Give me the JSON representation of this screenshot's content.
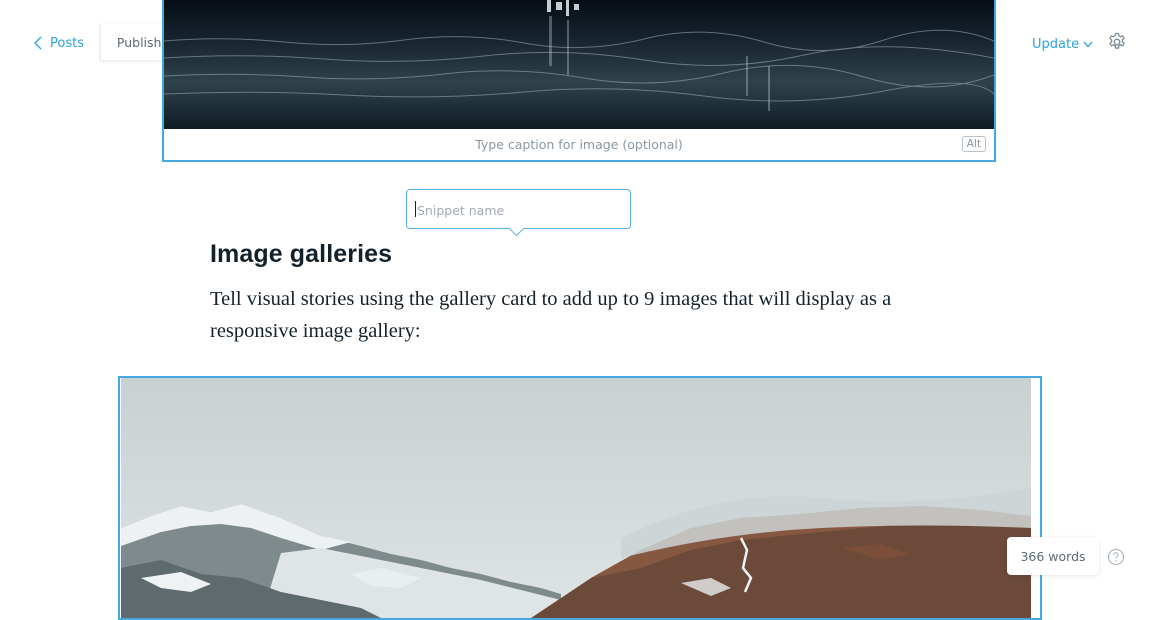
{
  "header": {
    "back_label": "Posts",
    "status": "Published",
    "update_label": "Update"
  },
  "image_card": {
    "caption_placeholder": "Type caption for image (optional)",
    "alt_label": "Alt"
  },
  "snippet": {
    "placeholder": "Snippet name"
  },
  "content": {
    "heading": "Image galleries",
    "paragraph": "Tell visual stories using the gallery card to add up to 9 images that will display as a responsive image gallery:"
  },
  "footer": {
    "word_count": "366 words"
  },
  "colors": {
    "accent": "#2aa2dd",
    "card_border": "#45a8df",
    "text": "#15212a",
    "muted": "#8a969f"
  },
  "icons": {
    "back": "chevron-left-icon",
    "update": "chevron-down-icon",
    "settings": "gear-icon",
    "help": "question-circle-icon"
  }
}
